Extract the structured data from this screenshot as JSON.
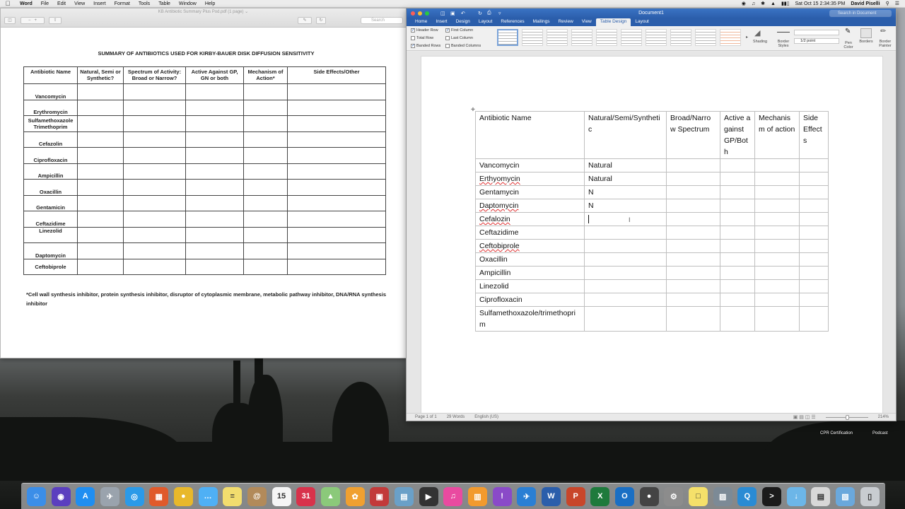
{
  "menubar": {
    "apple_glyph": "",
    "app_name": "Word",
    "items": [
      "File",
      "Edit",
      "View",
      "Insert",
      "Format",
      "Tools",
      "Table",
      "Window",
      "Help"
    ],
    "datetime": "Sat Oct 15  2:34:35 PM",
    "user": "David Piselli"
  },
  "pdf": {
    "window_title": "KB Antibiotic Summary Plus Pod.pdf (1 page) ⌄",
    "search_placeholder": "Search",
    "heading": "SUMMARY OF ANTIBIOTICS USED FOR KIRBY-BAUER DISK DIFFUSION SENSITIVITY",
    "columns": [
      "Antibiotic Name",
      "Natural, Semi or Synthetic?",
      "Spectrum of Activity: Broad or Narrow?",
      "Active Against  GP, GN or both",
      "Mechanism of Action*",
      "Side Effects/Other"
    ],
    "rows": [
      "Vancomycin",
      "Erythromycin",
      "Sulfamethoxazole Trimethoprim",
      "Cefazolin",
      "Ciprofloxacin",
      "Ampicillin",
      "Oxacillin",
      "Gentamicin",
      "Ceftazidime",
      "Linezolid",
      "Daptomycin",
      "Ceftobiprole"
    ],
    "footnote": "*Cell wall synthesis inhibitor, protein synthesis inhibitor, disruptor of cytoplasmic membrane, metabolic pathway inhibitor, DNA/RNA synthesis inhibitor"
  },
  "word": {
    "doc_title": "Document1",
    "search_placeholder": "Search in Document",
    "tabs": [
      "Home",
      "Insert",
      "Design",
      "Layout",
      "References",
      "Mailings",
      "Review",
      "View",
      "Table Design",
      "Layout"
    ],
    "active_tab": "Table Design",
    "ribbon": {
      "header_row": "Header Row",
      "first_column": "First Column",
      "total_row": "Total Row",
      "last_column": "Last Column",
      "banded_rows": "Banded Rows",
      "banded_columns": "Banded Columns",
      "shading": "Shading",
      "border_styles": "Border Styles",
      "pen_weight": "1/2 point",
      "pen_color": "Pen Color",
      "borders": "Borders",
      "border_painter": "Border Painter"
    },
    "table": {
      "headers": [
        "Antibiotic Name",
        "Natural/Semi/Synthetic",
        "Broad/Narrow Spectrum",
        "Active against GP/Both",
        "Mechanism of action",
        "Side Effects"
      ],
      "rows": [
        {
          "name": "Vancomycin",
          "natural": "Natural",
          "spell": false
        },
        {
          "name": "Erthyomycin",
          "natural": "Natural",
          "spell": true
        },
        {
          "name": "Gentamycin",
          "natural": "N",
          "spell": false
        },
        {
          "name": "Daptomycin",
          "natural": "N",
          "spell": true
        },
        {
          "name": "Cefalozin",
          "natural": "",
          "spell": true
        },
        {
          "name": "Ceftazidime",
          "natural": "",
          "spell": false
        },
        {
          "name": "Ceftobiprole",
          "natural": "",
          "spell": true
        },
        {
          "name": "Oxacillin",
          "natural": "",
          "spell": false
        },
        {
          "name": "Ampicillin",
          "natural": "",
          "spell": false
        },
        {
          "name": "Linezolid",
          "natural": "",
          "spell": false
        },
        {
          "name": "Ciprofloxacin",
          "natural": "",
          "spell": false
        },
        {
          "name": "Sulfamethoxazole/trimethoprim",
          "natural": "",
          "spell": false
        }
      ]
    },
    "status": {
      "page": "Page 1 of 1",
      "words": "29 Words",
      "language": "English (US)",
      "zoom": "214%"
    }
  },
  "desktop": {
    "labels": [
      "CPR Certification",
      "Podcast"
    ]
  },
  "dock": {
    "icons": [
      {
        "name": "finder-icon",
        "color": "#3b8ee8",
        "glyph": "☺"
      },
      {
        "name": "siri-icon",
        "color": "#5b3fbf",
        "glyph": "◉"
      },
      {
        "name": "app-store-icon",
        "color": "#1f8ef1",
        "glyph": "A"
      },
      {
        "name": "launchpad-icon",
        "color": "#9aa3ad",
        "glyph": "✈"
      },
      {
        "name": "safari-icon",
        "color": "#2b9ae8",
        "glyph": "◎"
      },
      {
        "name": "grid-apps-icon",
        "color": "#e05a2b",
        "glyph": "▦"
      },
      {
        "name": "chrome-icon",
        "color": "#e8b82b",
        "glyph": "●"
      },
      {
        "name": "messages-icon",
        "color": "#4fb0f5",
        "glyph": "…"
      },
      {
        "name": "notes-icon",
        "color": "#f2dd6e",
        "glyph": "≡"
      },
      {
        "name": "contacts-icon",
        "color": "#b28a5a",
        "glyph": "@"
      },
      {
        "name": "calendar-icon",
        "color": "#f5f5f5",
        "glyph": "15"
      },
      {
        "name": "fantastical-icon",
        "color": "#d8324b",
        "glyph": "31"
      },
      {
        "name": "maps-icon",
        "color": "#8bc97a",
        "glyph": "▲"
      },
      {
        "name": "photos-icon",
        "color": "#f0a030",
        "glyph": "✿"
      },
      {
        "name": "photo-booth-icon",
        "color": "#c23a3a",
        "glyph": "▣"
      },
      {
        "name": "preview-icon",
        "color": "#6aa0c8",
        "glyph": "▤"
      },
      {
        "name": "imovie-icon",
        "color": "#333333",
        "glyph": "▶"
      },
      {
        "name": "itunes-icon",
        "color": "#e94aa0",
        "glyph": "♫"
      },
      {
        "name": "ibooks-icon",
        "color": "#f29a2e",
        "glyph": "▥"
      },
      {
        "name": "alert-icon",
        "color": "#8a4ac8",
        "glyph": "!"
      },
      {
        "name": "testflight-icon",
        "color": "#2a7fd4",
        "glyph": "✈"
      },
      {
        "name": "word-icon",
        "color": "#2b5eab",
        "glyph": "W"
      },
      {
        "name": "powerpoint-icon",
        "color": "#c8462a",
        "glyph": "P"
      },
      {
        "name": "excel-icon",
        "color": "#1e7a3c",
        "glyph": "X"
      },
      {
        "name": "outlook-icon",
        "color": "#1a6fc4",
        "glyph": "O"
      },
      {
        "name": "dvd-player-icon",
        "color": "#444444",
        "glyph": "●"
      },
      {
        "name": "system-preferences-icon",
        "color": "#8c8c8c",
        "glyph": "⚙"
      },
      {
        "name": "stickies-icon",
        "color": "#f5e06a",
        "glyph": "□"
      },
      {
        "name": "image-capture-icon",
        "color": "#7c8a96",
        "glyph": "▨"
      },
      {
        "name": "quicktime-icon",
        "color": "#2a8bd4",
        "glyph": "Q"
      },
      {
        "name": "terminal-icon",
        "color": "#1b1b1b",
        "glyph": ">"
      },
      {
        "name": "downloads-folder-icon",
        "color": "#6cb6e8",
        "glyph": "↓"
      },
      {
        "name": "documents-stack-icon",
        "color": "#d8d8d8",
        "glyph": "▤"
      },
      {
        "name": "documents-folder-icon",
        "color": "#6aa8dc",
        "glyph": "▧"
      },
      {
        "name": "trash-icon",
        "color": "#c8ccd0",
        "glyph": "▯"
      }
    ]
  }
}
